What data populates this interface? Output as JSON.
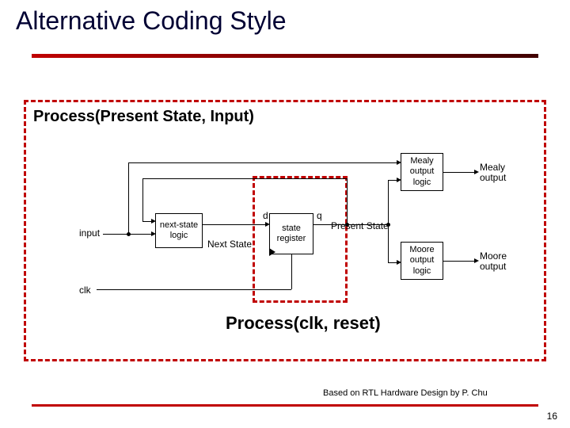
{
  "title": "Alternative Coding Style",
  "outer_process": "Process(Present State, Input)",
  "inner_process": "Process(clk, reset)",
  "labels": {
    "next_state": "Next State",
    "present_state": "Present State",
    "input": "input",
    "clk": "clk",
    "d": "d",
    "q": "q"
  },
  "blocks": {
    "next_state_logic": "next-state\nlogic",
    "state_register": "state\nregister",
    "mealy_logic": "Mealy\noutput\nlogic",
    "moore_logic": "Moore\noutput\nlogic",
    "mealy_output": "Mealy\noutput",
    "moore_output": "Moore\noutput"
  },
  "footer": "Based on RTL Hardware Design by P. Chu",
  "page_number": "16"
}
